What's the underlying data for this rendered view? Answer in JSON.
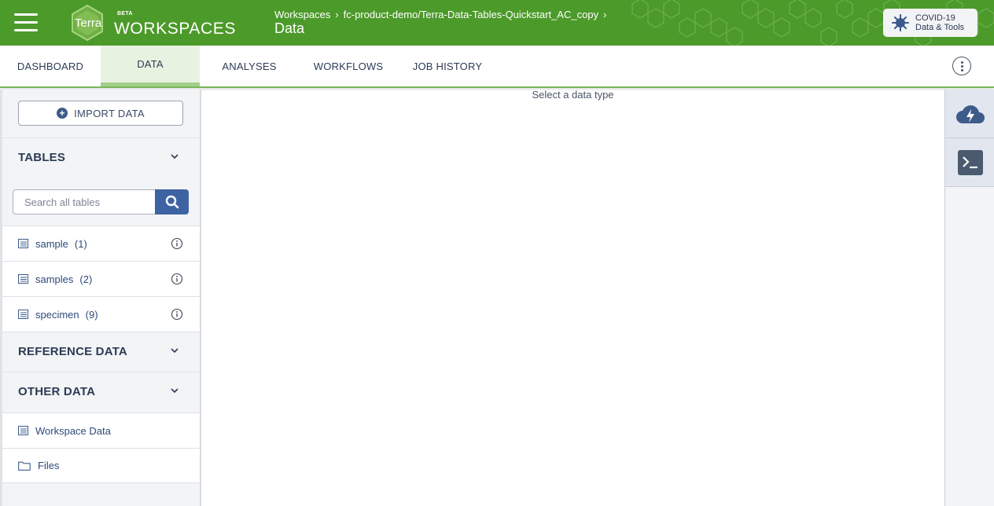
{
  "header": {
    "logo_text": "Terra",
    "beta": "BETA",
    "app_title": "WORKSPACES",
    "breadcrumb": [
      "Workspaces",
      "fc-product-demo/Terra-Data-Tables-Quickstart_AC_copy"
    ],
    "page_title": "Data",
    "covid_button": {
      "line1": "COVID-19",
      "line2": "Data & Tools"
    },
    "brand_color": "#4c9a2a"
  },
  "tabs": [
    "DASHBOARD",
    "DATA",
    "ANALYSES",
    "WORKFLOWS",
    "JOB HISTORY"
  ],
  "active_tab": "DATA",
  "sidebar": {
    "import_label": "IMPORT DATA",
    "tables_header": "TABLES",
    "search_placeholder": "Search all tables",
    "tables": [
      {
        "name": "sample",
        "count": "(1)"
      },
      {
        "name": "samples",
        "count": "(2)"
      },
      {
        "name": "specimen",
        "count": "(9)"
      }
    ],
    "reference_header": "REFERENCE DATA",
    "other_header": "OTHER DATA",
    "other_items": [
      "Workspace Data",
      "Files"
    ]
  },
  "main": {
    "message": "Select a data type"
  },
  "rail": {
    "icons": [
      "cloud-compute-icon",
      "terminal-icon"
    ]
  }
}
